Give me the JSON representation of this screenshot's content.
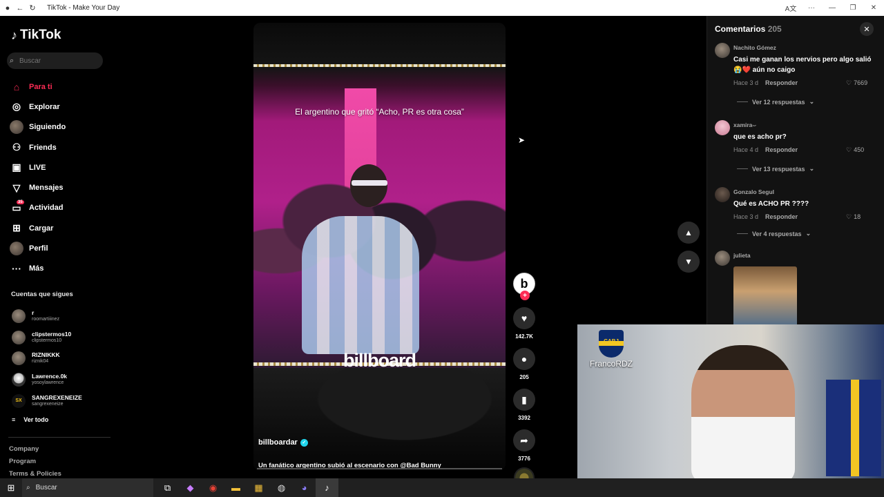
{
  "window": {
    "title": "TikTok - Make Your Day"
  },
  "sidebar": {
    "logo": "TikTok",
    "search_placeholder": "Buscar",
    "nav": [
      {
        "label": "Para ti",
        "icon": "home-icon",
        "active": true
      },
      {
        "label": "Explorar",
        "icon": "compass-icon"
      },
      {
        "label": "Siguiendo",
        "icon": "avatar-icon"
      },
      {
        "label": "Friends",
        "icon": "friends-icon"
      },
      {
        "label": "LIVE",
        "icon": "live-icon"
      },
      {
        "label": "Mensajes",
        "icon": "send-icon"
      },
      {
        "label": "Actividad",
        "icon": "inbox-icon",
        "badge": "35"
      },
      {
        "label": "Cargar",
        "icon": "upload-icon"
      },
      {
        "label": "Perfil",
        "icon": "profile-avatar"
      },
      {
        "label": "Más",
        "icon": "more-icon"
      }
    ],
    "following_title": "Cuentas que sigues",
    "following": [
      {
        "name": "r",
        "handle": "roomartiiinez"
      },
      {
        "name": "clipstermos10",
        "handle": "clipstermos10"
      },
      {
        "name": "RIZNIKKK",
        "handle": "riznik04"
      },
      {
        "name": "Lawrence.0k",
        "handle": "yosoylawrence"
      },
      {
        "name": "SANGREXENEIZE",
        "handle": "sangrexeneize",
        "avatar_text": "SX"
      }
    ],
    "see_all": "Ver todo",
    "footer": [
      "Company",
      "Program",
      "Terms & Policies"
    ]
  },
  "video": {
    "caption": "El argentino que gritó “Acho, PR es otra cosa”",
    "watermark": "billboard",
    "author": "billboardar",
    "description": "Un fanático argentino subió al escenario con @Bad Bunny"
  },
  "actions": {
    "creator_initial": "b",
    "likes": "142.7K",
    "comments": "205",
    "saves": "3392",
    "shares": "3776"
  },
  "comments_panel": {
    "title": "Comentarios",
    "count": "205",
    "items": [
      {
        "user": "Nachito Gómez",
        "text": "Casi me ganan los nervios pero algo salió 😭❤️ aún no caigo",
        "time": "Hace 3 d",
        "reply": "Responder",
        "likes": "7669",
        "replies": "Ver 12 respuestas"
      },
      {
        "user": "xamira⌣",
        "text": "que es acho pr?",
        "time": "Hace 4 d",
        "reply": "Responder",
        "likes": "450",
        "replies": "Ver 13 respuestas"
      },
      {
        "user": "Gonzalo Segul",
        "text": "Qué es ACHO PR ????",
        "time": "Hace 3 d",
        "reply": "Responder",
        "likes": "18",
        "replies": "Ver 4 respuestas"
      },
      {
        "user": "julieta"
      }
    ]
  },
  "webcam": {
    "club_abbr": "CABJ",
    "username": "FrancoRDZ"
  },
  "taskbar": {
    "search_label": "Buscar"
  }
}
